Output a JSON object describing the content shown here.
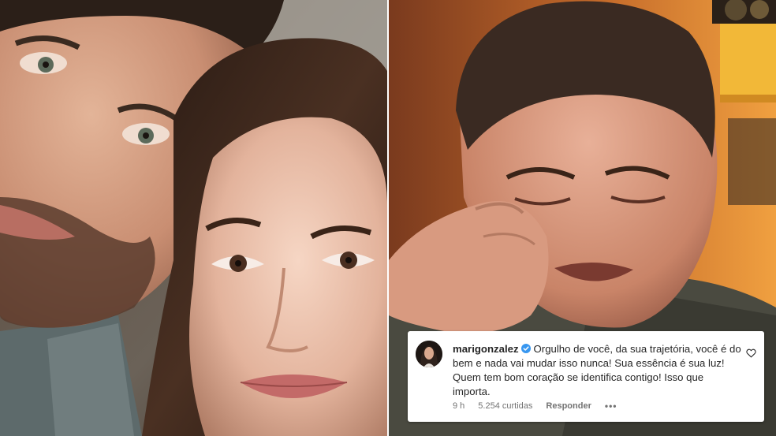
{
  "comment": {
    "username": "marigonzalez",
    "text": "Orgulho de você, da sua trajetória, você é do bem e nada vai mudar isso nunca! Sua essência é sua luz! Quem tem bom coração se identifica contigo! Isso que importa.",
    "time": "9 h",
    "likes": "5.254 curtidas",
    "reply_label": "Responder",
    "more_label": "•••"
  },
  "colors": {
    "verified": "#3897f0",
    "card_background": "#ffffff",
    "text_primary": "#262626",
    "text_secondary": "#737373"
  },
  "icons": {
    "verified": "verified-badge-icon",
    "heart": "heart-outline-icon",
    "more": "more-options-icon"
  }
}
